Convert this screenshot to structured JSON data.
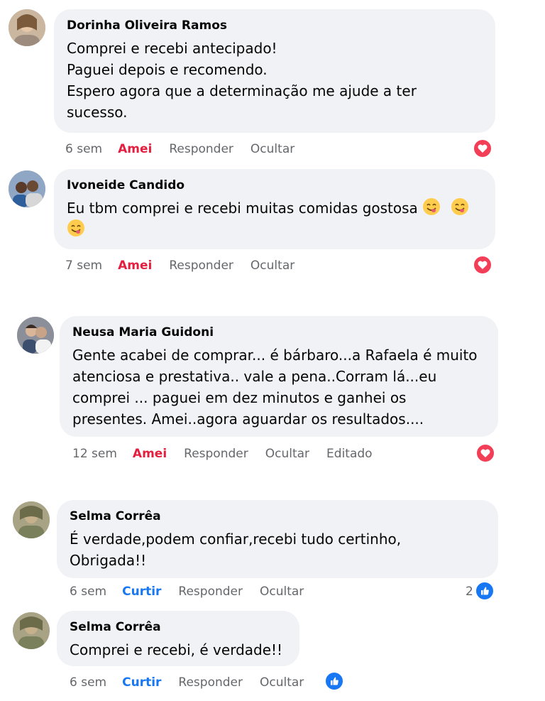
{
  "comments": [
    {
      "author": "Dorinha Oliveira Ramos",
      "lines": [
        "Comprei e recebi antecipado!",
        "Paguei depois e recomendo.",
        "Espero agora que a determinação me ajude a ter",
        "sucesso."
      ],
      "time": "6 sem",
      "reaction_label": "Amei",
      "reply_label": "Responder",
      "hide_label": "Ocultar",
      "reaction_icon": "love-icon"
    },
    {
      "author": "Ivoneide Candido",
      "lines": [
        "Eu tbm comprei e recebi muitas comidas gostosa"
      ],
      "emoji": "yum-face-emoji",
      "time": "7 sem",
      "reaction_label": "Amei",
      "reply_label": "Responder",
      "hide_label": "Ocultar",
      "reaction_icon": "love-icon"
    },
    {
      "author": "Neusa Maria Guidoni",
      "lines": [
        "Gente acabei de comprar... é bárbaro...a Rafaela é muito",
        "atenciosa e prestativa.. vale a pena..Corram lá...eu",
        "comprei ... paguei em dez minutos e ganhei os",
        "presentes. Amei..agora aguardar os resultados...."
      ],
      "time": "12 sem",
      "reaction_label": "Amei",
      "reply_label": "Responder",
      "hide_label": "Ocultar",
      "edited_label": "Editado",
      "reaction_icon": "love-icon"
    },
    {
      "author": "Selma Corrêa",
      "lines": [
        "É verdade,podem confiar,recebi tudo certinho,",
        "Obrigada!!"
      ],
      "time": "6 sem",
      "reaction_label": "Curtir",
      "reply_label": "Responder",
      "hide_label": "Ocultar",
      "reaction_count": "2",
      "reaction_icon": "like-icon"
    },
    {
      "author": "Selma Corrêa",
      "lines": [
        "Comprei e recebi, é verdade!!"
      ],
      "time": "6 sem",
      "reaction_label": "Curtir",
      "reply_label": "Responder",
      "hide_label": "Ocultar",
      "reaction_icon": "like-icon"
    }
  ],
  "colors": {
    "bubble": "#f0f2f5",
    "love": "#f33e58",
    "like": "#1877f2",
    "amei_text": "#e41e3f",
    "meta_text": "#65676b"
  }
}
